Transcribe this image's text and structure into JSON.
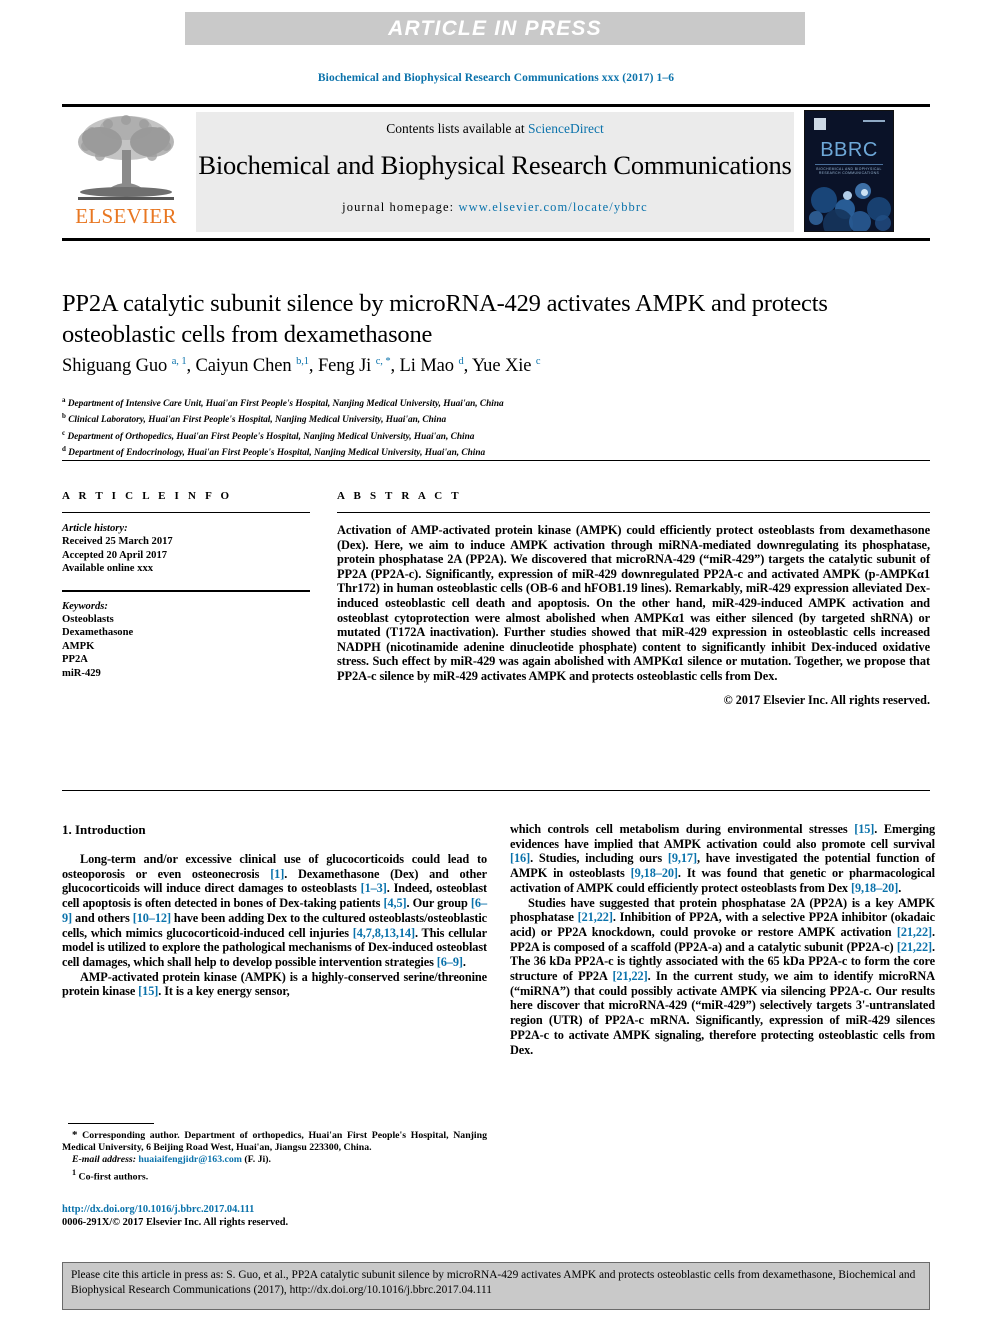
{
  "banner": {
    "text": "ARTICLE IN PRESS"
  },
  "running_head": "Biochemical and Biophysical Research Communications xxx (2017) 1–6",
  "masthead": {
    "contents_label": "Contents lists available at ",
    "sciencedirect": "ScienceDirect",
    "journal_name": "Biochemical and Biophysical Research Communications",
    "homepage_label": "journal homepage: ",
    "homepage_url": "www.elsevier.com/locate/ybbrc",
    "publisher": "ELSEVIER",
    "cover_title": "BBRC",
    "cover_subtitle": "BIOCHEMICAL AND BIOPHYSICAL RESEARCH COMMUNICATIONS"
  },
  "article": {
    "title": "PP2A catalytic subunit silence by microRNA-429 activates AMPK and protects osteoblastic cells from dexamethasone",
    "authors_html": "Shiguang Guo <sup>a, 1</sup>, Caiyun Chen <sup>b,1</sup>, Feng Ji <sup>c, *</sup>, Li Mao <sup>d</sup>, Yue Xie <sup>c</sup>",
    "affiliations": [
      {
        "mark": "a",
        "text": "Department of Intensive Care Unit, Huai'an First People's Hospital, Nanjing Medical University, Huai'an, China"
      },
      {
        "mark": "b",
        "text": "Clinical Laboratory, Huai'an First People's Hospital, Nanjing Medical University, Huai'an, China"
      },
      {
        "mark": "c",
        "text": "Department of Orthopedics, Huai'an First People's Hospital, Nanjing Medical University, Huai'an, China"
      },
      {
        "mark": "d",
        "text": "Department of Endocrinology, Huai'an First People's Hospital, Nanjing Medical University, Huai'an, China"
      }
    ]
  },
  "article_info": {
    "heading": "A R T I C L E   I N F O",
    "history_label": "Article history:",
    "history": [
      "Received 25 March 2017",
      "Accepted 20 April 2017",
      "Available online xxx"
    ],
    "keywords_label": "Keywords:",
    "keywords": [
      "Osteoblasts",
      "Dexamethasone",
      "AMPK",
      "PP2A",
      "miR-429"
    ]
  },
  "abstract": {
    "heading": "A B S T R A C T",
    "text": "Activation of AMP-activated protein kinase (AMPK) could efficiently protect osteoblasts from dexamethasone (Dex). Here, we aim to induce AMPK activation through miRNA-mediated downregulating its phosphatase, protein phosphatase 2A (PP2A). We discovered that microRNA-429 (“miR-429”) targets the catalytic subunit of PP2A (PP2A-c). Significantly, expression of miR-429 downregulated PP2A-c and activated AMPK (p-AMPKα1 Thr172) in human osteoblastic cells (OB-6 and hFOB1.19 lines). Remarkably, miR-429 expression alleviated Dex-induced osteoblastic cell death and apoptosis. On the other hand, miR-429-induced AMPK activation and osteoblast cytoprotection were almost abolished when AMPKα1 was either silenced (by targeted shRNA) or mutated (T172A inactivation). Further studies showed that miR-429 expression in osteoblastic cells increased NADPH (nicotinamide adenine dinucleotide phosphate) content to significantly inhibit Dex-induced oxidative stress. Such effect by miR-429 was again abolished with AMPKα1 silence or mutation. Together, we propose that PP2A-c silence by miR-429 activates AMPK and protects osteoblastic cells from Dex.",
    "copyright": "© 2017 Elsevier Inc. All rights reserved."
  },
  "body": {
    "section_heading": "1.  Introduction",
    "left_paragraph_1_html": "Long-term and/or excessive clinical use of glucocorticoids could lead to osteoporosis or even osteonecrosis <span class=\"ref\">[1]</span>. Dexamethasone (Dex) and other glucocorticoids will induce direct damages to osteoblasts <span class=\"ref\">[1–3]</span>. Indeed, osteoblast cell apoptosis is often detected in bones of Dex-taking patients <span class=\"ref\">[4,5]</span>. Our group <span class=\"ref\">[6–9]</span> and others <span class=\"ref\">[10–12]</span> have been adding Dex to the cultured osteoblasts/osteoblastic cells, which mimics glucocorticoid-induced cell injuries <span class=\"ref\">[4,7,8,13,14]</span>. This cellular model is utilized to explore the pathological mechanisms of Dex-induced osteoblast cell damages, which shall help to develop possible intervention strategies <span class=\"ref\">[6–9]</span>.",
    "left_paragraph_2_html": "AMP-activated protein kinase (AMPK) is a highly-conserved serine/threonine protein kinase <span class=\"ref\">[15]</span>. It is a key energy sensor,",
    "right_paragraph_1_html": "which controls cell metabolism during environmental stresses <span class=\"ref\">[15]</span>. Emerging evidences have implied that AMPK activation could also promote cell survival <span class=\"ref\">[16]</span>. Studies, including ours <span class=\"ref\">[9,17]</span>, have investigated the potential function of AMPK in osteoblasts <span class=\"ref\">[9,18–20]</span>. It was found that genetic or pharmacological activation of AMPK could efficiently protect osteoblasts from Dex <span class=\"ref\">[9,18–20]</span>.",
    "right_paragraph_2_html": "Studies have suggested that protein phosphatase 2A (PP2A) is a key AMPK phosphatase <span class=\"ref\">[21,22]</span>. Inhibition of PP2A, with a selective PP2A inhibitor (okadaic acid) or PP2A knockdown, could provoke or restore AMPK activation <span class=\"ref\">[21,22]</span>. PP2A is composed of a scaffold (PP2A-a) and a catalytic subunit (PP2A-c) <span class=\"ref\">[21,22]</span>. The 36 kDa PP2A-c is tightly associated with the 65 kDa PP2A-c to form the core structure of PP2A <span class=\"ref\">[21,22]</span>. In the current study, we aim to identify microRNA (“miRNA”) that could possibly activate AMPK via silencing PP2A-c. Our results here discover that microRNA-429 (“miR-429”) selectively targets 3'-untranslated region (UTR) of PP2A-c mRNA. Significantly, expression of miR-429 silences PP2A-c to activate AMPK signaling, therefore protecting osteoblastic cells from Dex."
  },
  "footnotes": {
    "corresponding_html": "<span style=\"font-size:11px;\">*</span> Corresponding author. Department of orthopedics, Huai'an First People's Hospital, Nanjing Medical University, 6 Beijing Road West, Huai'an, Jiangsu 223300, China.",
    "email_label": "E-mail address:",
    "email": "huaiaifengjidr@163.com",
    "email_suffix": "(F. Ji).",
    "cofirst_mark": "1",
    "cofirst": "Co-first authors.",
    "doi_url": "http://dx.doi.org/10.1016/j.bbrc.2017.04.111",
    "issn_line": "0006-291X/© 2017 Elsevier Inc. All rights reserved."
  },
  "cite_box": {
    "text": "Please cite this article in press as: S. Guo, et al., PP2A catalytic subunit silence by microRNA-429 activates AMPK and protects osteoblastic cells from dexamethasone, Biochemical and Biophysical Research Communications (2017), http://dx.doi.org/10.1016/j.bbrc.2017.04.111"
  },
  "colors": {
    "link": "#0a72ab",
    "elsevier_orange": "#e87722",
    "banner_grey": "#c9c9c9",
    "masthead_grey": "#ebebeb"
  }
}
